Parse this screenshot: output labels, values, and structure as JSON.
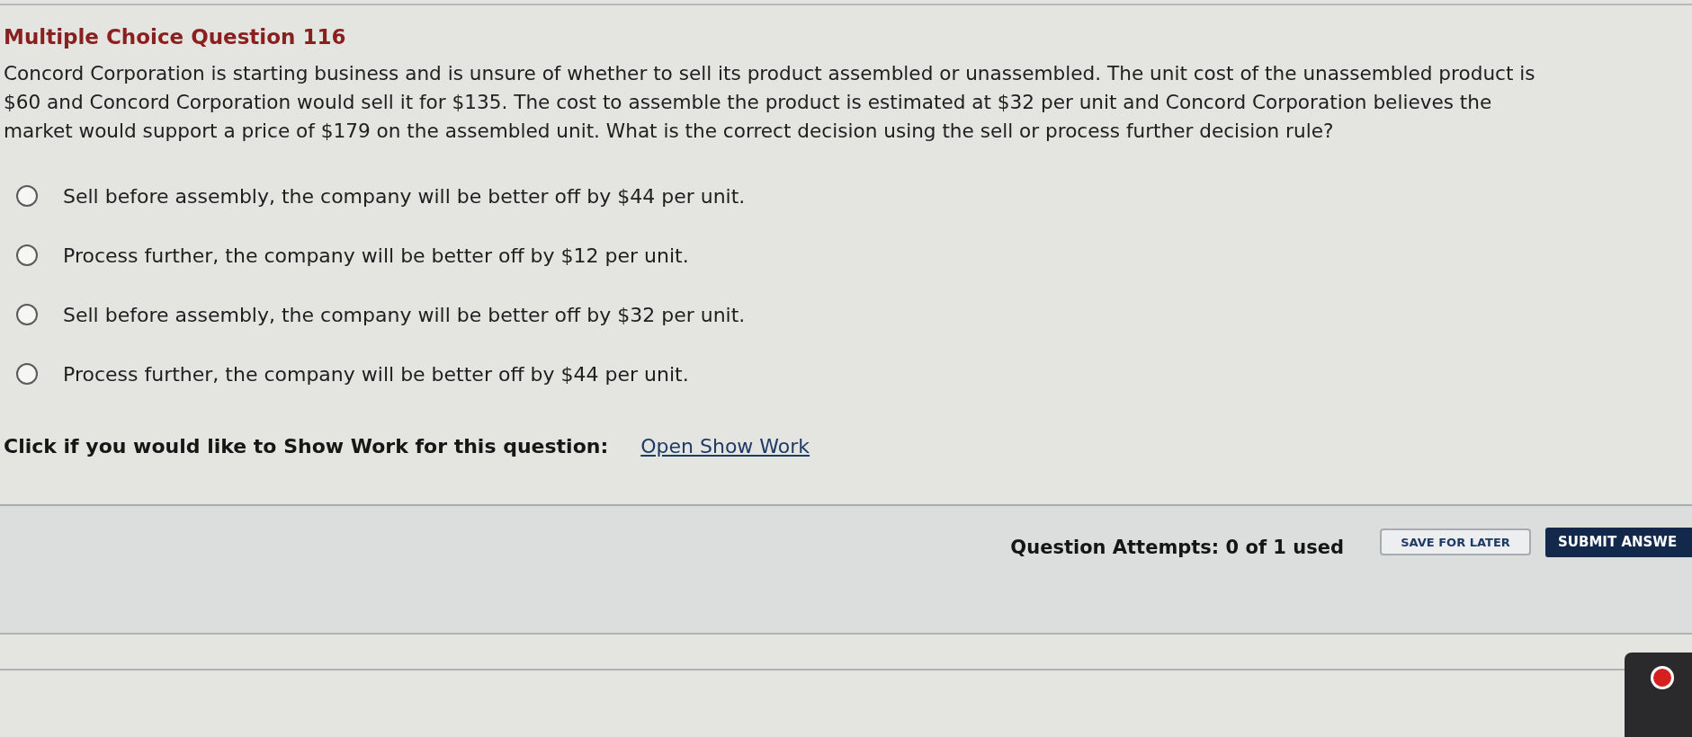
{
  "question": {
    "title": "Multiple Choice Question 116",
    "text": "Concord Corporation is starting business and is unsure of whether to sell its product assembled or unassembled. The unit cost of the unassembled product is $60 and Concord Corporation would sell it for $135. The cost to assemble the product is estimated at $32 per unit and Concord Corporation believes the market would support a price of $179 on the assembled unit. What is the correct decision using the sell or process further decision rule?"
  },
  "options": [
    {
      "label": "Sell before assembly, the company will be better off by $44 per unit.",
      "selected": false
    },
    {
      "label": "Process further, the company will be better off by $12 per unit.",
      "selected": false
    },
    {
      "label": "Sell before assembly, the company will be better off by $32 per unit.",
      "selected": false
    },
    {
      "label": "Process further, the company will be better off by $44 per unit.",
      "selected": false
    }
  ],
  "show_work": {
    "prompt": "Click if you would like to Show Work for this question:",
    "link": "Open Show Work"
  },
  "footer": {
    "attempts": "Question Attempts: 0 of 1 used",
    "buttons": [
      {
        "label": "SAVE FOR LATER",
        "kind": "secondary"
      },
      {
        "label": "SUBMIT ANSWE",
        "kind": "primary"
      }
    ]
  }
}
